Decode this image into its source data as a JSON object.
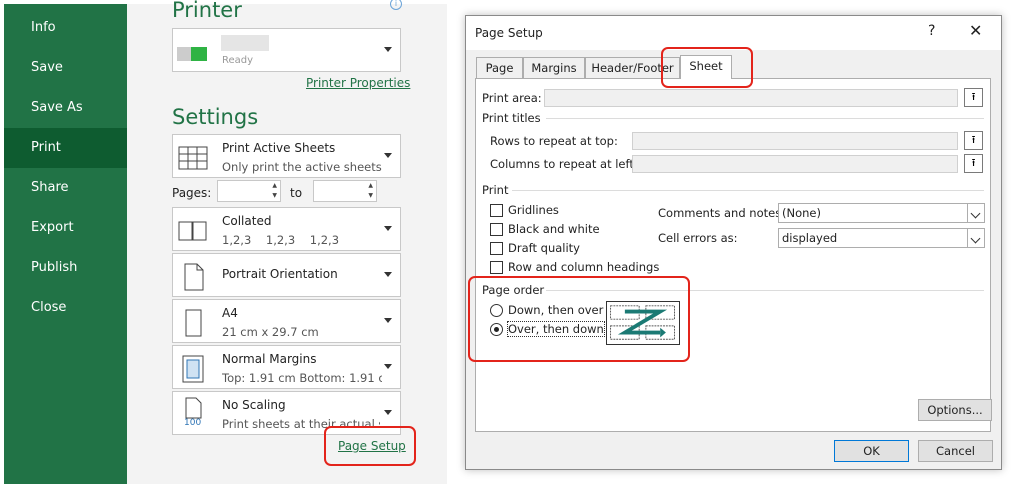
{
  "nav": {
    "items": [
      {
        "label": "Info"
      },
      {
        "label": "Save"
      },
      {
        "label": "Save As"
      },
      {
        "label": "Print"
      },
      {
        "label": "Share"
      },
      {
        "label": "Export"
      },
      {
        "label": "Publish"
      },
      {
        "label": "Close"
      }
    ],
    "active": "Print"
  },
  "print_pane": {
    "printer_heading": "Printer",
    "printer_name": "Ready",
    "printer_properties_link": "Printer Properties",
    "settings_heading": "Settings",
    "what_to_print": {
      "title": "Print Active Sheets",
      "subtitle": "Only print the active sheets"
    },
    "pages_label": "Pages:",
    "to_label": "to",
    "collation": {
      "title": "Collated",
      "subtitle": "1,2,3    1,2,3    1,2,3"
    },
    "orientation": {
      "title": "Portrait Orientation"
    },
    "paper": {
      "title": "A4",
      "subtitle": "21 cm x 29.7 cm"
    },
    "margins": {
      "title": "Normal Margins",
      "subtitle": "Top: 1.91 cm Bottom: 1.91 c..."
    },
    "scaling": {
      "title": "No Scaling",
      "subtitle": "Print sheets at their actual size",
      "badge": "100"
    },
    "page_setup_link": "Page Setup"
  },
  "dialog": {
    "title": "Page Setup",
    "help": "?",
    "close": "✕",
    "tabs": [
      {
        "label": "Page"
      },
      {
        "label": "Margins"
      },
      {
        "label": "Header/Footer"
      },
      {
        "label": "Sheet"
      }
    ],
    "active_tab": "Sheet",
    "print_area_label": "Print area:",
    "print_titles_label": "Print titles",
    "rows_repeat_label": "Rows to repeat at top:",
    "cols_repeat_label": "Columns to repeat at left:",
    "picker_glyph": "⭱",
    "print_group_label": "Print",
    "checkboxes": [
      {
        "label": "Gridlines",
        "checked": false
      },
      {
        "label": "Black and white",
        "checked": false
      },
      {
        "label": "Draft quality",
        "checked": false
      },
      {
        "label": "Row and column headings",
        "checked": false
      }
    ],
    "comments_label": "Comments and notes:",
    "comments_value": "(None)",
    "cell_errors_label": "Cell errors as:",
    "cell_errors_value": "displayed",
    "page_order_label": "Page order",
    "page_order_options": [
      {
        "label": "Down, then over",
        "selected": false
      },
      {
        "label": "Over, then down",
        "selected": true
      }
    ],
    "options_button": "Options...",
    "ok_button": "OK",
    "cancel_button": "Cancel"
  },
  "colors": {
    "excel_green": "#217346",
    "nav_active": "#0e5c30",
    "highlight_red": "#e3241b",
    "arrow_teal": "#1b7a74"
  }
}
